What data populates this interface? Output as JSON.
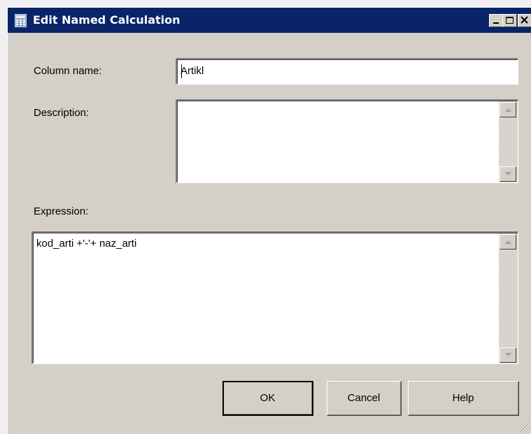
{
  "window": {
    "title": "Edit Named Calculation",
    "icon": "calculator-icon",
    "controls": [
      "minimize",
      "maximize",
      "close"
    ]
  },
  "form": {
    "column_name_label": "Column name:",
    "column_name_value": "Artikl",
    "description_label": "Description:",
    "description_value": "",
    "expression_label": "Expression:",
    "expression_value": "kod_arti +'-'+ naz_arti"
  },
  "buttons": {
    "ok": "OK",
    "cancel": "Cancel",
    "help": "Help"
  },
  "colors": {
    "titlebar": "#0a246a",
    "face": "#d4d0c8"
  }
}
